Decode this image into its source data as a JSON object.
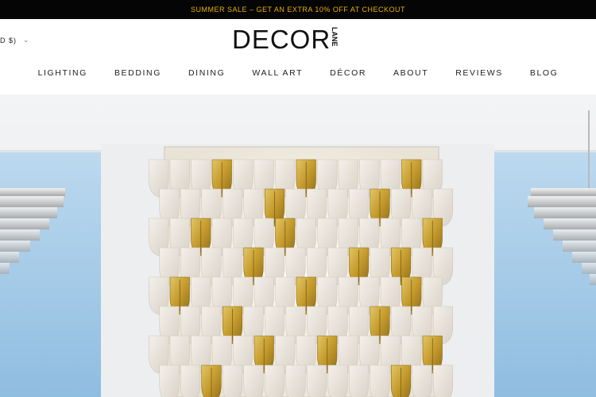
{
  "promo": {
    "text": "SUMMER SALE – GET AN EXTRA 10% OFF AT CHECKOUT"
  },
  "header": {
    "currency": "D $)",
    "logo_main": "DECOR",
    "logo_sub": "LANE"
  },
  "nav": {
    "items": [
      "LIGHTING",
      "BEDDING",
      "DINING",
      "WALL ART",
      "DÉCOR",
      "ABOUT",
      "REVIEWS",
      "BLOG"
    ]
  },
  "colors": {
    "promo_bg": "#050505",
    "promo_text": "#e8b200",
    "gold_tile": "#c9a437",
    "white_tile": "#ebe6df",
    "sky": "#a9cde8"
  }
}
